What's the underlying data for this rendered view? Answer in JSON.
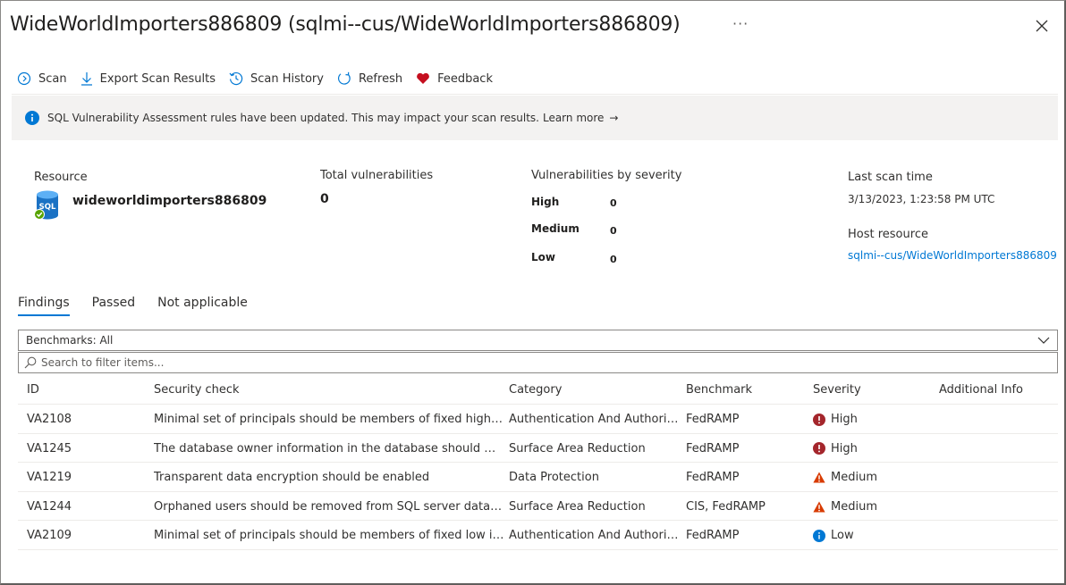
{
  "header": {
    "title": "WideWorldImporters886809 (sqlmi--cus/WideWorldImporters886809)",
    "more": "···"
  },
  "toolbar": {
    "scan": "Scan",
    "export": "Export Scan Results",
    "history": "Scan History",
    "refresh": "Refresh",
    "feedback": "Feedback"
  },
  "banner": {
    "text": "SQL Vulnerability Assessment rules have been updated. This may impact your scan results.",
    "link": "Learn more",
    "arrow": "→"
  },
  "summary": {
    "resource_label": "Resource",
    "resource_name": "wideworldimporters886809",
    "resource_icon_text": "SQL",
    "total_label": "Total vulnerabilities",
    "total_value": "0",
    "severity_label": "Vulnerabilities by severity",
    "high_label": "High",
    "high_value": "0",
    "medium_label": "Medium",
    "medium_value": "0",
    "low_label": "Low",
    "low_value": "0",
    "last_scan_label": "Last scan time",
    "last_scan_value": "3/13/2023, 1:23:58 PM UTC",
    "host_label": "Host resource",
    "host_value": "sqlmi--cus/WideWorldImporters886809"
  },
  "tabs": {
    "findings": "Findings",
    "passed": "Passed",
    "not_applicable": "Not applicable"
  },
  "filter": {
    "benchmarks": "Benchmarks: All",
    "search_placeholder": "Search to filter items..."
  },
  "table": {
    "headers": {
      "id": "ID",
      "check": "Security check",
      "category": "Category",
      "benchmark": "Benchmark",
      "severity": "Severity",
      "additional": "Additional Info"
    },
    "rows": [
      {
        "id": "VA2108",
        "check": "Minimal set of principals should be members of fixed high imp...",
        "category": "Authentication And Authoriza...",
        "benchmark": "FedRAMP",
        "severity": "High",
        "sev_icon": "error-icon",
        "additional": ""
      },
      {
        "id": "VA1245",
        "check": "The database owner information in the database should match ...",
        "category": "Surface Area Reduction",
        "benchmark": "FedRAMP",
        "severity": "High",
        "sev_icon": "error-icon",
        "additional": ""
      },
      {
        "id": "VA1219",
        "check": "Transparent data encryption should be enabled",
        "category": "Data Protection",
        "benchmark": "FedRAMP",
        "severity": "Medium",
        "sev_icon": "warning-icon",
        "additional": ""
      },
      {
        "id": "VA1244",
        "check": "Orphaned users should be removed from SQL server databases",
        "category": "Surface Area Reduction",
        "benchmark": "CIS, FedRAMP",
        "severity": "Medium",
        "sev_icon": "warning-icon",
        "additional": ""
      },
      {
        "id": "VA2109",
        "check": "Minimal set of principals should be members of fixed low impa...",
        "category": "Authentication And Authoriza...",
        "benchmark": "FedRAMP",
        "severity": "Low",
        "sev_icon": "info-icon",
        "additional": ""
      }
    ]
  },
  "colors": {
    "accent": "#0078d4",
    "high": "#a4262c",
    "medium": "#d83b01",
    "low": "#0078d4",
    "feedback_heart": "#c50f1f"
  }
}
